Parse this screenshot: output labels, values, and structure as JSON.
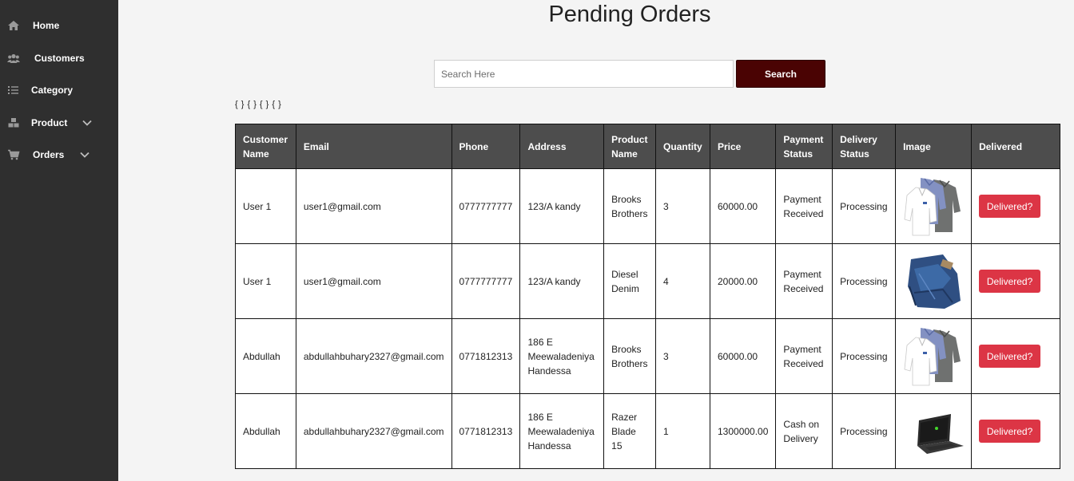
{
  "sidebar": {
    "items": [
      {
        "label": "Home",
        "icon": "home-icon"
      },
      {
        "label": "Customers",
        "icon": "users-icon"
      },
      {
        "label": "Category",
        "icon": "list-icon"
      },
      {
        "label": "Product",
        "icon": "box-icon"
      },
      {
        "label": "Orders",
        "icon": "cart-icon"
      }
    ]
  },
  "page": {
    "title": "Pending Orders",
    "braces": "{ } { } { } { }"
  },
  "search": {
    "placeholder": "Search Here",
    "value": "",
    "button_label": "Search"
  },
  "table": {
    "headers": [
      "Customer Name",
      "Email",
      "Phone",
      "Address",
      "Product Name",
      "Quantity",
      "Price",
      "Payment Status",
      "Delivery Status",
      "Image",
      "Delivered"
    ],
    "rows": [
      {
        "customer": "User 1",
        "email": "user1@gmail.com",
        "phone": "0777777777",
        "address": "123/A kandy",
        "product": "Brooks Brothers",
        "quantity": "3",
        "price": "60000.00",
        "payment": "Payment Received",
        "delivery": "Processing",
        "image": "shirts-image",
        "action": "Delivered?"
      },
      {
        "customer": "User 1",
        "email": "user1@gmail.com",
        "phone": "0777777777",
        "address": "123/A kandy",
        "product": "Diesel Denim",
        "quantity": "4",
        "price": "20000.00",
        "payment": "Payment Received",
        "delivery": "Processing",
        "image": "jeans-image",
        "action": "Delivered?"
      },
      {
        "customer": "Abdullah",
        "email": "abdullahbuhary2327@gmail.com",
        "phone": "0771812313",
        "address": "186 E Meewaladeniya Handessa",
        "product": "Brooks Brothers",
        "quantity": "3",
        "price": "60000.00",
        "payment": "Payment Received",
        "delivery": "Processing",
        "image": "shirts-image",
        "action": "Delivered?"
      },
      {
        "customer": "Abdullah",
        "email": "abdullahbuhary2327@gmail.com",
        "phone": "0771812313",
        "address": "186 E Meewaladeniya Handessa",
        "product": "Razer Blade 15",
        "quantity": "1",
        "price": "1300000.00",
        "payment": "Cash on Delivery",
        "delivery": "Processing",
        "image": "laptop-image",
        "action": "Delivered?"
      }
    ]
  },
  "colors": {
    "sidebar_bg": "#2f2f2f",
    "header_bg": "#4d4d4d",
    "search_button": "#4a0303",
    "delivered_button": "#dc3545"
  }
}
